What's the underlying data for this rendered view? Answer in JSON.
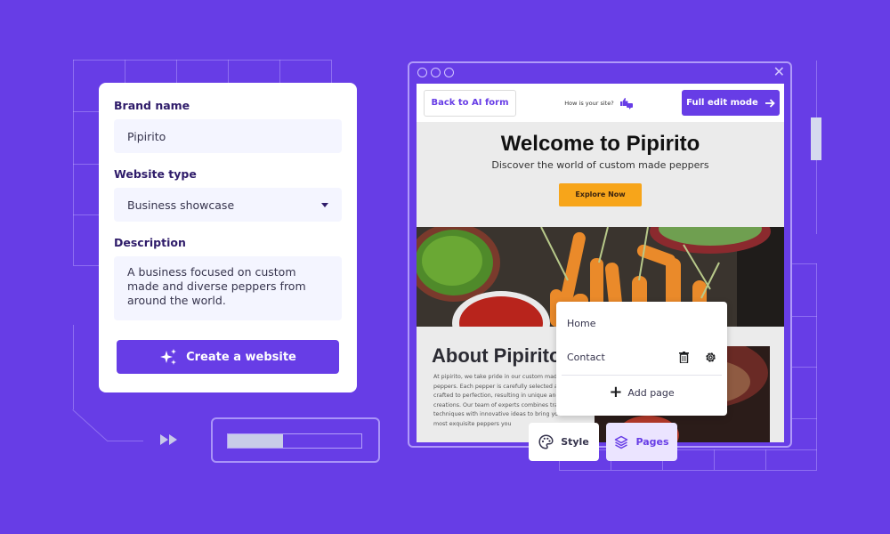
{
  "form": {
    "brand_label": "Brand name",
    "brand_value": "Pipirito",
    "type_label": "Website type",
    "type_value": "Business showcase",
    "description_label": "Description",
    "description_value": "A business focused on custom made and diverse peppers from around the world.",
    "create_button": "Create a website",
    "create_icon": "sparkles-icon"
  },
  "progress": {
    "value_percent": 41
  },
  "browser": {
    "close_icon": "close-icon",
    "topbar": {
      "back_button": "Back to AI form",
      "rating_prompt": "How is your site?",
      "rating_icon": "thumbs-up-down-icon",
      "full_edit_button": "Full edit mode",
      "full_edit_icon": "arrow-right-icon"
    },
    "hero": {
      "title": "Welcome to Pipirito",
      "subtitle": "Discover the world of custom made peppers",
      "cta": "Explore Now"
    },
    "about": {
      "title": "About Pipirito",
      "body": "At pipirito, we take pride in our custom made peppers. Each pepper is carefully selected and crafted to perfection, resulting in unique and flavorful creations. Our team of experts combines traditional techniques with innovative ideas to bring you the most exquisite peppers you"
    }
  },
  "pages_menu": {
    "items": [
      {
        "label": "Home"
      },
      {
        "label": "Contact",
        "actions": [
          "trash-icon",
          "gear-icon"
        ]
      }
    ],
    "add_page": "Add page"
  },
  "toolbar": {
    "style_label": "Style",
    "pages_label": "Pages"
  },
  "colors": {
    "brand": "#673de6",
    "cta": "#f7a51a"
  }
}
